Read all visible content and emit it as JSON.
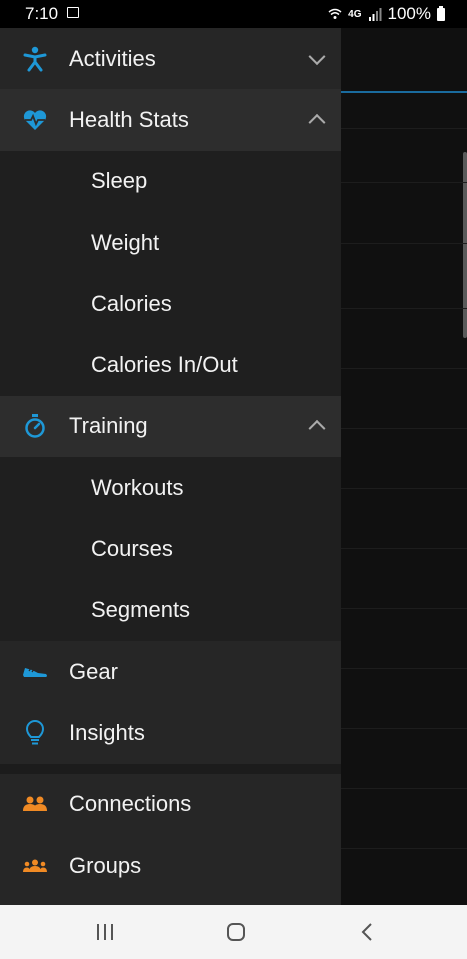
{
  "status_bar": {
    "time": "7:10",
    "network": "4G",
    "battery": "100%"
  },
  "drawer": {
    "activities": "Activities",
    "health_stats": "Health Stats",
    "sleep": "Sleep",
    "weight": "Weight",
    "calories": "Calories",
    "calories_inout": "Calories In/Out",
    "training": "Training",
    "workouts": "Workouts",
    "courses": "Courses",
    "segments": "Segments",
    "gear": "Gear",
    "insights": "Insights",
    "connections": "Connections",
    "groups": "Groups"
  },
  "colors": {
    "accent_blue": "#1e98d7",
    "accent_orange": "#f08a24"
  }
}
